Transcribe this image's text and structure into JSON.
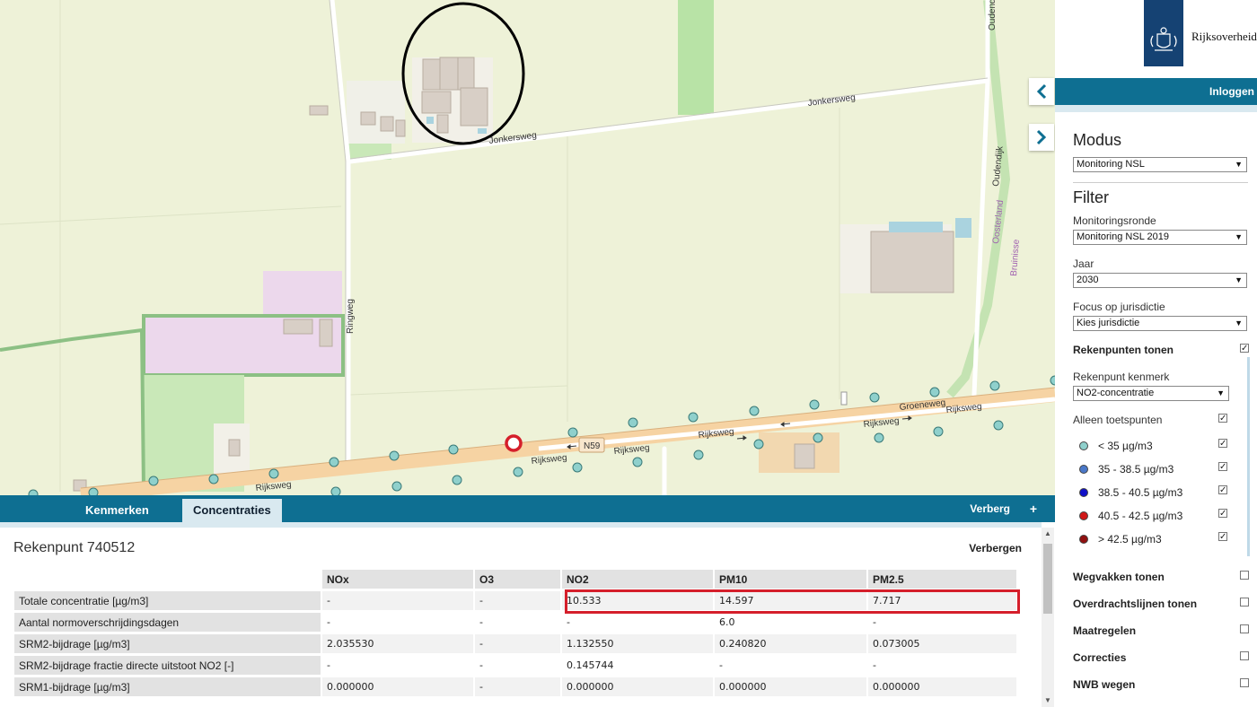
{
  "map": {
    "roads": {
      "jonkersweg_1": "Jonkersweg",
      "jonkersweg_2": "Jonkersweg",
      "ringweg": "Ringweg",
      "oudendijk_1": "Oudendijk",
      "oudendijk_2": "Oudendijk",
      "rijksweg_1": "Rijksweg",
      "rijksweg_2": "Rijksweg",
      "rijksweg_3": "Rijksweg",
      "rijksweg_4": "Rijksweg",
      "rijksweg_5": "Rijksweg",
      "rijksweg_6": "Rijksweg",
      "groeneweg": "Groeneweg",
      "n59": "N59"
    },
    "places": {
      "oosterland": "Oosterland",
      "bruinisse": "Bruinisse"
    }
  },
  "bottom_panel": {
    "tabs": [
      {
        "label": "Kenmerken"
      },
      {
        "label": "Concentraties",
        "active": true
      }
    ],
    "verberg_label": "Verberg",
    "plus_label": "+",
    "title": "Rekenpunt 740512",
    "verbergen_label": "Verbergen",
    "table": {
      "columns": [
        "",
        "NOx",
        "O3",
        "NO2",
        "PM10",
        "PM2.5"
      ],
      "rows": [
        {
          "label": "Totale concentratie [µg/m3]",
          "values": [
            "-",
            "-",
            "10.533",
            "14.597",
            "7.717"
          ]
        },
        {
          "label": "Aantal normoverschrijdingsdagen",
          "values": [
            "-",
            "-",
            "-",
            "6.0",
            "-"
          ]
        },
        {
          "label": "SRM2-bijdrage [µg/m3]",
          "values": [
            "2.035530",
            "-",
            "1.132550",
            "0.240820",
            "0.073005"
          ]
        },
        {
          "label": "SRM2-bijdrage fractie directe uitstoot NO2 [-]",
          "values": [
            "-",
            "-",
            "0.145744",
            "-",
            "-"
          ]
        },
        {
          "label": "SRM1-bijdrage [µg/m3]",
          "values": [
            "0.000000",
            "-",
            "0.000000",
            "0.000000",
            "0.000000"
          ]
        }
      ]
    }
  },
  "sidebar": {
    "logo_text": "Rijksoverheid",
    "login_label": "Inloggen",
    "modus": {
      "title": "Modus",
      "value": "Monitoring NSL"
    },
    "filter": {
      "title": "Filter",
      "monitoringsronde": {
        "label": "Monitoringsronde",
        "value": "Monitoring NSL 2019"
      },
      "jaar": {
        "label": "Jaar",
        "value": "2030"
      },
      "jurisdictie": {
        "label": "Focus op jurisdictie",
        "value": "Kies jurisdictie"
      }
    },
    "rekenpunten_tonen": {
      "label": "Rekenpunten tonen",
      "checked": true
    },
    "rekenpunt_kenmerk": {
      "label": "Rekenpunt kenmerk",
      "value": "NO2-concentratie"
    },
    "alleen_toetspunten": {
      "label": "Alleen toetspunten",
      "checked": true
    },
    "legend": [
      {
        "label": "< 35 µg/m3",
        "color": "#8fd0cc",
        "checked": true
      },
      {
        "label": "35 - 38.5 µg/m3",
        "color": "#4a78c8",
        "checked": true
      },
      {
        "label": "38.5 - 40.5 µg/m3",
        "color": "#1010c8",
        "checked": true
      },
      {
        "label": "40.5 - 42.5 µg/m3",
        "color": "#d01818",
        "checked": true
      },
      {
        "label": "> 42.5 µg/m3",
        "color": "#901010",
        "checked": true
      }
    ],
    "toggles": [
      {
        "label": "Wegvakken tonen",
        "checked": false
      },
      {
        "label": "Overdrachtslijnen tonen",
        "checked": false
      },
      {
        "label": "Maatregelen",
        "checked": false
      },
      {
        "label": "Correcties",
        "checked": false
      },
      {
        "label": "NWB wegen",
        "checked": false
      }
    ]
  },
  "colors": {
    "header_blue": "#0e6f92",
    "logo_blue": "#154273",
    "highlight_red": "#d51f2b",
    "road_orange": "#f6d3a3",
    "map_background": "#eef2d8"
  }
}
